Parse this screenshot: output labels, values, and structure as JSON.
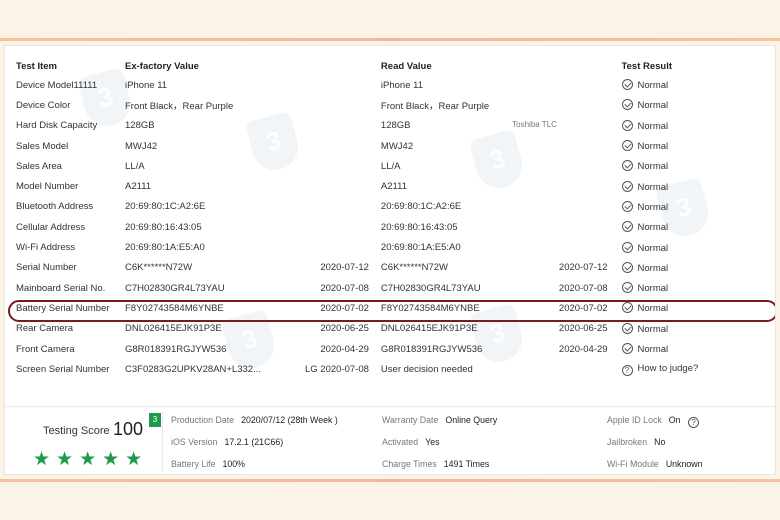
{
  "columns": {
    "item": "Test Item",
    "ex_factory": "Ex-factory Value",
    "read": "Read Value",
    "result": "Test Result"
  },
  "rows": [
    {
      "item": "Device Model11111",
      "ex": "iPhone 11",
      "ex_date": "",
      "read": "iPhone 11",
      "read_note": "",
      "read_date": "",
      "result": "Normal",
      "status": "check"
    },
    {
      "item": "Device Color",
      "ex": "Front Black，Rear Purple",
      "ex_date": "",
      "read": "Front Black，Rear Purple",
      "read_note": "",
      "read_date": "",
      "result": "Normal",
      "status": "check"
    },
    {
      "item": "Hard Disk Capacity",
      "ex": "128GB",
      "ex_date": "",
      "read": "128GB",
      "read_note": "Toshiba TLC",
      "read_date": "",
      "result": "Normal",
      "status": "check"
    },
    {
      "item": "Sales Model",
      "ex": "MWJ42",
      "ex_date": "",
      "read": "MWJ42",
      "read_note": "",
      "read_date": "",
      "result": "Normal",
      "status": "check"
    },
    {
      "item": "Sales Area",
      "ex": "LL/A",
      "ex_date": "",
      "read": "LL/A",
      "read_note": "",
      "read_date": "",
      "result": "Normal",
      "status": "check"
    },
    {
      "item": "Model Number",
      "ex": "A2111",
      "ex_date": "",
      "read": "A2111",
      "read_note": "",
      "read_date": "",
      "result": "Normal",
      "status": "check"
    },
    {
      "item": "Bluetooth Address",
      "ex": "20:69:80:1C:A2:6E",
      "ex_date": "",
      "read": "20:69:80:1C:A2:6E",
      "read_note": "",
      "read_date": "",
      "result": "Normal",
      "status": "check"
    },
    {
      "item": "Cellular Address",
      "ex": "20:69:80:16:43:05",
      "ex_date": "",
      "read": "20:69:80:16:43:05",
      "read_note": "",
      "read_date": "",
      "result": "Normal",
      "status": "check"
    },
    {
      "item": "Wi-Fi Address",
      "ex": "20:69:80:1A:E5:A0",
      "ex_date": "",
      "read": "20:69:80:1A:E5:A0",
      "read_note": "",
      "read_date": "",
      "result": "Normal",
      "status": "check"
    },
    {
      "item": "Serial Number",
      "ex": "C6K******N72W",
      "ex_date": "2020-07-12",
      "read": "C6K******N72W",
      "read_note": "",
      "read_date": "2020-07-12",
      "result": "Normal",
      "status": "check"
    },
    {
      "item": "Mainboard Serial No.",
      "ex": "C7H02830GR4L73YAU",
      "ex_date": "2020-07-08",
      "read": "C7H02830GR4L73YAU",
      "read_note": "",
      "read_date": "2020-07-08",
      "result": "Normal",
      "status": "check"
    },
    {
      "item": "Battery Serial Number",
      "ex": "F8Y02743584M6YNBE",
      "ex_date": "2020-07-02",
      "read": "F8Y02743584M6YNBE",
      "read_note": "",
      "read_date": "2020-07-02",
      "result": "Normal",
      "status": "check"
    },
    {
      "item": "Rear Camera",
      "ex": "DNL026415EJK91P3E",
      "ex_date": "2020-06-25",
      "read": "DNL026415EJK91P3E",
      "read_note": "",
      "read_date": "2020-06-25",
      "result": "Normal",
      "status": "check"
    },
    {
      "item": "Front Camera",
      "ex": "G8R018391RGJYW536",
      "ex_date": "2020-04-29",
      "read": "G8R018391RGJYW536",
      "read_note": "",
      "read_date": "2020-04-29",
      "result": "Normal",
      "status": "check"
    },
    {
      "item": "Screen Serial Number",
      "ex": "C3F0283G2UPKV28AN+L332...",
      "ex_date": "LG 2020-07-08",
      "read": "User decision needed",
      "read_note": "",
      "read_date": "",
      "result": "How to judge?",
      "status": "question"
    }
  ],
  "score": {
    "label": "Testing Score",
    "value": "100",
    "badge": "3",
    "stars": "★★★★★",
    "stars_count": 5
  },
  "info": {
    "production_date_label": "Production Date",
    "production_date_value": "2020/07/12 (28th Week )",
    "ios_version_label": "iOS Version",
    "ios_version_value": "17.2.1 (21C66)",
    "battery_life_label": "Battery Life",
    "battery_life_value": "100%",
    "warranty_date_label": "Warranty Date",
    "warranty_date_value": "Online Query",
    "activated_label": "Activated",
    "activated_value": "Yes",
    "charge_times_label": "Charge Times",
    "charge_times_value": "1491 Times",
    "apple_id_lock_label": "Apple ID Lock",
    "apple_id_lock_value": "On",
    "jailbroken_label": "Jailbroken",
    "jailbroken_value": "No",
    "wifi_module_label": "Wi-Fi Module",
    "wifi_module_value": "Unknown"
  },
  "colors": {
    "accent_green": "#1e9a4b",
    "highlight_border": "#7a1a22",
    "background": "#fbf3e6"
  }
}
